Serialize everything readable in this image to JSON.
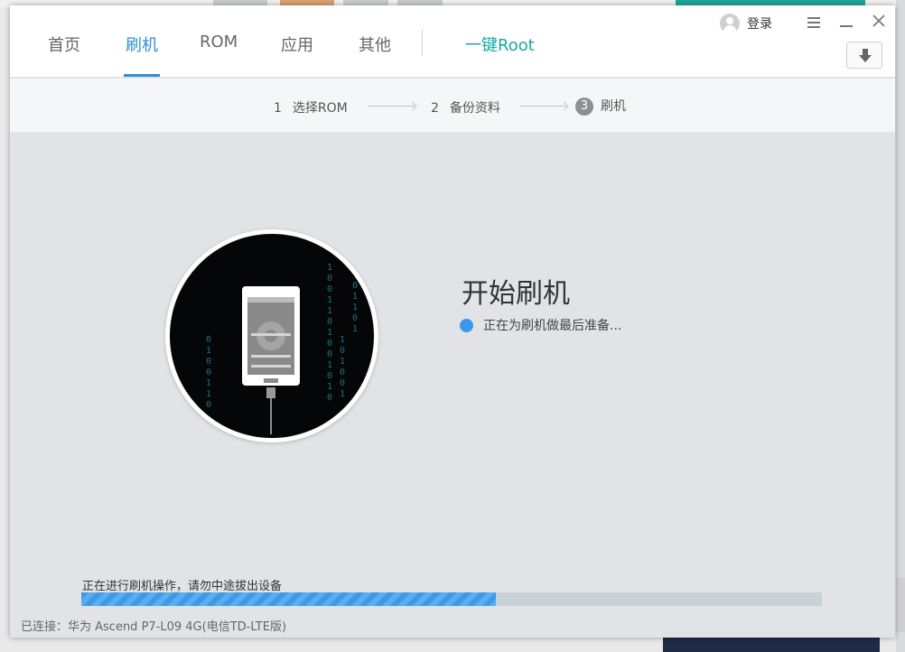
{
  "tabs": {
    "home": "首页",
    "flash": "刷机",
    "rom": "ROM",
    "apps": "应用",
    "other": "其他",
    "root": "一键Root"
  },
  "header": {
    "login_label": "登录",
    "menu_icon": "menu-icon",
    "minimize_icon": "minimize-icon",
    "close_icon": "close-icon",
    "download_icon": "download-icon"
  },
  "steps": [
    {
      "num": "1",
      "label": "选择ROM"
    },
    {
      "num": "2",
      "label": "备份资料"
    },
    {
      "num": "3",
      "label": "刷机"
    }
  ],
  "main": {
    "title": "开始刷机",
    "status_text": "正在为刷机做最后准备..."
  },
  "progress": {
    "label": "正在进行刷机操作，请勿中途拔出设备",
    "value": 0.56
  },
  "footer": {
    "connection": "已连接：华为 Ascend P7-L09 4G(电信TD-LTE版)"
  },
  "colors": {
    "accent": "#2d8fd6",
    "root_accent": "#17a8a0",
    "progress": "#3e9ae8"
  }
}
